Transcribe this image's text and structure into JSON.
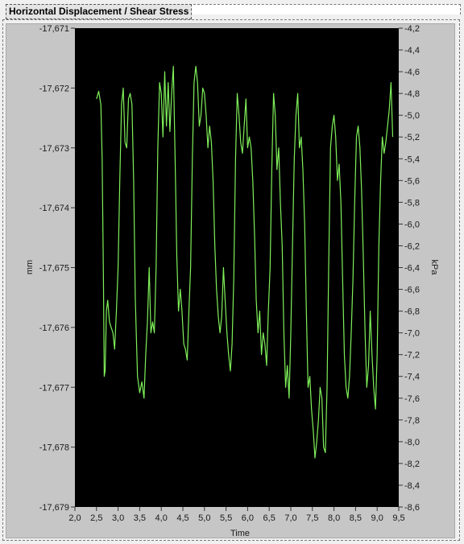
{
  "window": {
    "title": "Horizontal Displacement / Shear Stress"
  },
  "colors": {
    "plot_background": "#000000",
    "trace": "#7ff05a",
    "frame": "#c6c6c6"
  },
  "chart_data": {
    "type": "line",
    "title": "Horizontal Displacement / Shear Stress",
    "xlabel": "Time",
    "ylabel": "mm",
    "y2label": "kPa",
    "xlim": [
      2.0,
      9.5
    ],
    "ylim": [
      -17.679,
      -17.671
    ],
    "y2lim": [
      -8.6,
      -4.2
    ],
    "grid": false,
    "x_ticks": [
      "2,0",
      "2,5",
      "3,0",
      "3,5",
      "4,0",
      "4,5",
      "5,0",
      "5,5",
      "6,0",
      "6,5",
      "7,0",
      "7,5",
      "8,0",
      "8,5",
      "9,0",
      "9,5"
    ],
    "y_ticks": [
      "-17,671",
      "-17,672",
      "-17,673",
      "-17,674",
      "-17,675",
      "-17,676",
      "-17,677",
      "-17,678",
      "-17,679"
    ],
    "y2_ticks": [
      "-4,2",
      "-4,4",
      "-4,6",
      "-4,8",
      "-5,0",
      "-5,2",
      "-5,4",
      "-5,6",
      "-5,8",
      "-6,0",
      "-6,2",
      "-6,4",
      "-6,6",
      "-6,8",
      "-7,0",
      "-7,2",
      "-7,4",
      "-7,6",
      "-7,8",
      "-8,0",
      "-8,2",
      "-8,4",
      "-8,6"
    ],
    "series": [
      {
        "axis": "right",
        "x": [
          2.5,
          2.55,
          2.6,
          2.63,
          2.66,
          2.68,
          2.7,
          2.73,
          2.76,
          2.8,
          2.84,
          2.88,
          2.92,
          2.96,
          3.0,
          3.04,
          3.08,
          3.12,
          3.16,
          3.2,
          3.24,
          3.28,
          3.32,
          3.36,
          3.4,
          3.45,
          3.5,
          3.55,
          3.6,
          3.64,
          3.68,
          3.72,
          3.76,
          3.8,
          3.84,
          3.88,
          3.92,
          3.96,
          4.0,
          4.04,
          4.08,
          4.12,
          4.16,
          4.2,
          4.24,
          4.28,
          4.32,
          4.36,
          4.4,
          4.44,
          4.48,
          4.52,
          4.56,
          4.6,
          4.64,
          4.68,
          4.72,
          4.76,
          4.8,
          4.84,
          4.88,
          4.92,
          4.96,
          5.0,
          5.04,
          5.08,
          5.12,
          5.16,
          5.2,
          5.24,
          5.28,
          5.32,
          5.36,
          5.4,
          5.44,
          5.48,
          5.52,
          5.56,
          5.6,
          5.64,
          5.68,
          5.72,
          5.76,
          5.8,
          5.84,
          5.88,
          5.92,
          5.96,
          6.0,
          6.04,
          6.08,
          6.12,
          6.16,
          6.2,
          6.24,
          6.28,
          6.32,
          6.36,
          6.4,
          6.44,
          6.48,
          6.52,
          6.56,
          6.6,
          6.64,
          6.68,
          6.72,
          6.76,
          6.8,
          6.84,
          6.88,
          6.92,
          6.96,
          7.0,
          7.04,
          7.08,
          7.12,
          7.16,
          7.2,
          7.24,
          7.28,
          7.32,
          7.36,
          7.4,
          7.44,
          7.48,
          7.52,
          7.56,
          7.6,
          7.64,
          7.68,
          7.72,
          7.76,
          7.8,
          7.84,
          7.88,
          7.92,
          7.96,
          8.0,
          8.04,
          8.08,
          8.12,
          8.16,
          8.2,
          8.24,
          8.28,
          8.32,
          8.36,
          8.4,
          8.44,
          8.48,
          8.52,
          8.56,
          8.6,
          8.64,
          8.68,
          8.72,
          8.76,
          8.8,
          8.84,
          8.88,
          8.92,
          8.96,
          9.0,
          9.04,
          9.08,
          9.12,
          9.16,
          9.2,
          9.24,
          9.28,
          9.32,
          9.36
        ],
        "y": [
          -4.85,
          -4.78,
          -4.9,
          -5.4,
          -6.5,
          -7.4,
          -7.35,
          -6.8,
          -6.7,
          -6.9,
          -6.95,
          -7.0,
          -7.15,
          -6.8,
          -6.4,
          -5.6,
          -4.9,
          -4.75,
          -5.25,
          -5.3,
          -4.85,
          -4.8,
          -4.9,
          -5.6,
          -6.7,
          -7.4,
          -7.55,
          -7.45,
          -7.6,
          -7.2,
          -6.9,
          -6.4,
          -7.0,
          -6.9,
          -7.0,
          -6.4,
          -5.3,
          -4.7,
          -4.8,
          -5.2,
          -4.6,
          -5.1,
          -4.7,
          -5.15,
          -4.8,
          -4.55,
          -5.4,
          -6.3,
          -6.8,
          -6.6,
          -6.8,
          -7.1,
          -7.15,
          -7.25,
          -6.8,
          -6.4,
          -5.4,
          -4.7,
          -4.55,
          -4.7,
          -5.1,
          -5.0,
          -4.75,
          -4.8,
          -5.0,
          -5.3,
          -5.1,
          -5.25,
          -5.6,
          -6.2,
          -6.6,
          -6.85,
          -7.0,
          -6.85,
          -6.4,
          -6.7,
          -7.0,
          -7.2,
          -7.35,
          -7.1,
          -6.5,
          -5.4,
          -4.8,
          -5.0,
          -5.25,
          -5.35,
          -5.1,
          -4.85,
          -5.3,
          -5.2,
          -5.3,
          -5.6,
          -6.1,
          -6.7,
          -7.0,
          -6.8,
          -7.2,
          -7.0,
          -7.1,
          -7.3,
          -6.8,
          -6.4,
          -5.5,
          -4.8,
          -5.0,
          -5.5,
          -5.3,
          -5.8,
          -6.2,
          -7.0,
          -7.5,
          -7.3,
          -7.6,
          -7.0,
          -6.2,
          -5.4,
          -5.0,
          -4.8,
          -5.3,
          -5.2,
          -5.5,
          -6.0,
          -6.8,
          -7.5,
          -7.4,
          -7.7,
          -7.9,
          -8.15,
          -8.0,
          -7.8,
          -7.5,
          -7.6,
          -8.05,
          -8.1,
          -7.5,
          -6.3,
          -5.3,
          -5.1,
          -5.0,
          -5.2,
          -5.6,
          -5.45,
          -5.8,
          -6.5,
          -7.2,
          -7.5,
          -7.6,
          -7.4,
          -7.0,
          -6.5,
          -5.8,
          -5.2,
          -5.1,
          -5.3,
          -5.7,
          -6.3,
          -7.0,
          -7.5,
          -7.3,
          -6.8,
          -7.2,
          -7.5,
          -7.7,
          -7.2,
          -6.2,
          -5.6,
          -5.2,
          -5.35,
          -5.25,
          -5.1,
          -4.95,
          -4.7,
          -5.2
        ]
      }
    ]
  }
}
